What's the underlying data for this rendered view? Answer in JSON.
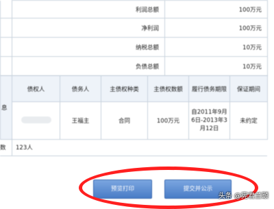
{
  "top_rows": [
    {
      "label": "利润总额",
      "value": "100万元"
    },
    {
      "label": "净利润",
      "value": "100万元"
    },
    {
      "label": "纳税总额",
      "value": "10万元"
    },
    {
      "label": "负债总额",
      "value": "10万元"
    }
  ],
  "guarantee_table": {
    "left_label_fragment": "息",
    "headers": [
      "债权人",
      "债务人",
      "主债权种类",
      "主债权数额",
      "履行债务期限",
      "保证期间"
    ],
    "row": {
      "creditor": "",
      "debtor": "王福主",
      "type": "合同",
      "amount": "100万元",
      "term": "自2011年9月6日-2013年3月12日",
      "guarantee_period": "未约定"
    }
  },
  "employee_row": {
    "label_fragment": "数",
    "value": "123人"
  },
  "buttons": {
    "preview": "预览打印",
    "submit": "提交并公示"
  },
  "watermark": "头条 @宪君兰颐",
  "colors": {
    "annotation_red": "#ff1f1f",
    "button_blue": "#4a7cc6"
  }
}
